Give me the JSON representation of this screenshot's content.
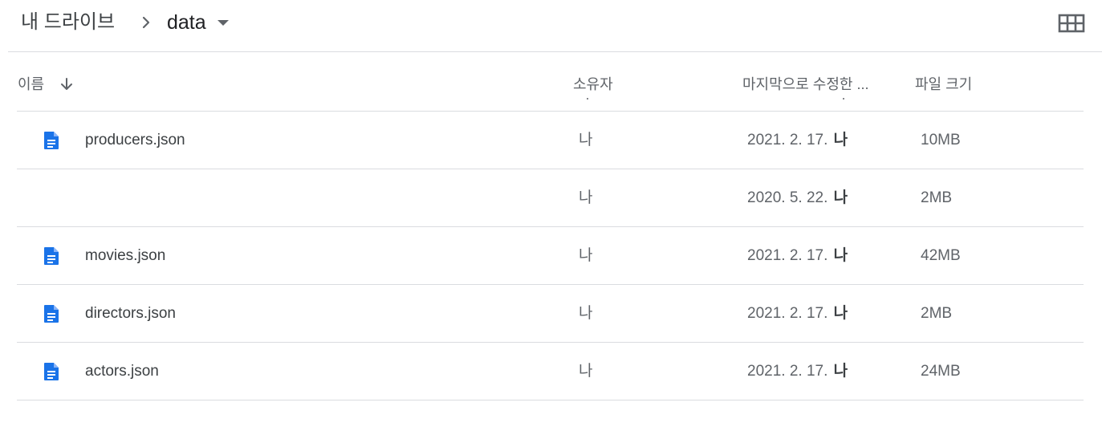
{
  "breadcrumb": {
    "root_label": "내 드라이브",
    "separator_icon": "chevron-right-icon",
    "current_label": "data",
    "current_menu_icon": "caret-down-icon"
  },
  "toolbar": {
    "view_toggle_icon": "grid-view-icon"
  },
  "columns": {
    "name": "이름",
    "name_sort_icon": "arrow-down-icon",
    "owner": "소유자",
    "modified": "마지막으로 수정한 ...",
    "size": "파일 크기"
  },
  "rows": [
    {
      "name": "producers.json",
      "owner": "나",
      "date": "2021. 2. 17.",
      "modifier": "나",
      "size": "10MB",
      "icon": "docs-file-icon"
    },
    {
      "name": "",
      "owner": "나",
      "date": "2020. 5. 22.",
      "modifier": "나",
      "size": "2MB",
      "icon": ""
    },
    {
      "name": "movies.json",
      "owner": "나",
      "date": "2021. 2. 17.",
      "modifier": "나",
      "size": "42MB",
      "icon": "docs-file-icon"
    },
    {
      "name": "directors.json",
      "owner": "나",
      "date": "2021. 2. 17.",
      "modifier": "나",
      "size": "2MB",
      "icon": "docs-file-icon"
    },
    {
      "name": "actors.json",
      "owner": "나",
      "date": "2021. 2. 17.",
      "modifier": "나",
      "size": "24MB",
      "icon": "docs-file-icon"
    }
  ],
  "colors": {
    "file_icon": "#1a73e8",
    "divider": "#dadce0",
    "text_primary": "#3c4043",
    "text_secondary": "#5f6368"
  }
}
